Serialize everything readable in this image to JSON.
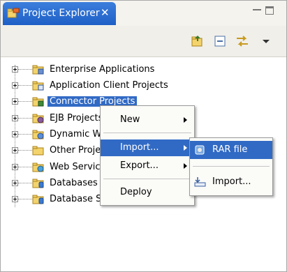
{
  "window": {
    "tab_title": "Project Explorer",
    "close_glyph": "✕"
  },
  "tree": {
    "items": [
      {
        "label": "Enterprise Applications",
        "icon": "enterprise-app-folder-icon"
      },
      {
        "label": "Application Client Projects",
        "icon": "app-client-folder-icon"
      },
      {
        "label": "Connector Projects",
        "icon": "connector-folder-icon",
        "selected": true
      },
      {
        "label": "EJB Projects",
        "icon": "ejb-folder-icon"
      },
      {
        "label": "Dynamic Web Projects",
        "icon": "dynamic-web-folder-icon"
      },
      {
        "label": "Other Projects",
        "icon": "folder-icon"
      },
      {
        "label": "Web Services",
        "icon": "web-services-folder-icon"
      },
      {
        "label": "Databases",
        "icon": "database-folder-icon"
      },
      {
        "label": "Database Servers",
        "icon": "database-server-folder-icon"
      }
    ]
  },
  "context_menu": {
    "items": [
      {
        "label": "New",
        "submenu": true
      },
      {
        "label": "Import...",
        "submenu": true,
        "active": true
      },
      {
        "label": "Export...",
        "submenu": true
      },
      {
        "label": "Deploy",
        "submenu": false
      }
    ],
    "visible_labels": {
      "new": "New",
      "import": "Import...",
      "export": "Export...",
      "deploy": "Deploy"
    }
  },
  "import_submenu": {
    "rar": "RAR file",
    "import": "Import..."
  },
  "colors": {
    "selection": "#316ac5",
    "tab": "#2a6bd3"
  }
}
